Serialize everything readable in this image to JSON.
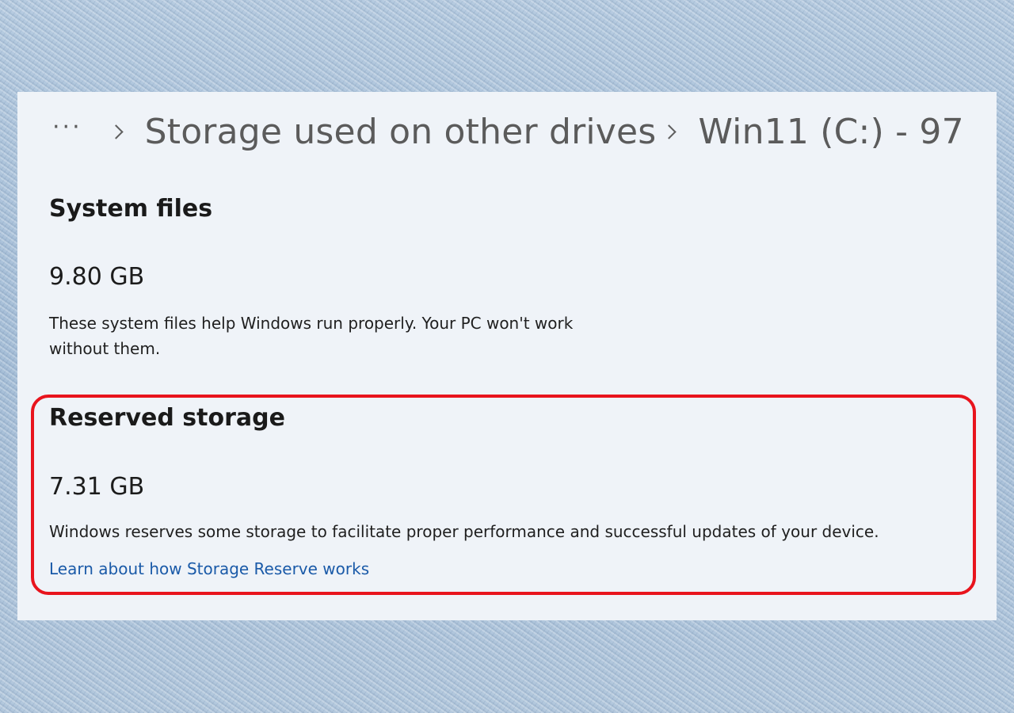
{
  "breadcrumb": {
    "more": "···",
    "items": [
      "Storage used on other drives",
      "Win11 (C:) - 97"
    ]
  },
  "system_files": {
    "title": "System files",
    "size": "9.80 GB",
    "description_line1": "These system files help Windows run properly. Your PC won't work",
    "description_line2": "without them."
  },
  "reserved_storage": {
    "title": "Reserved storage",
    "size": "7.31 GB",
    "description": "Windows reserves some storage to facilitate proper performance and successful updates of your device.",
    "link": "Learn about how Storage Reserve works"
  },
  "colors": {
    "highlight": "#e8141d",
    "link": "#1a5aa8",
    "panel_background": "#eff3f8"
  }
}
